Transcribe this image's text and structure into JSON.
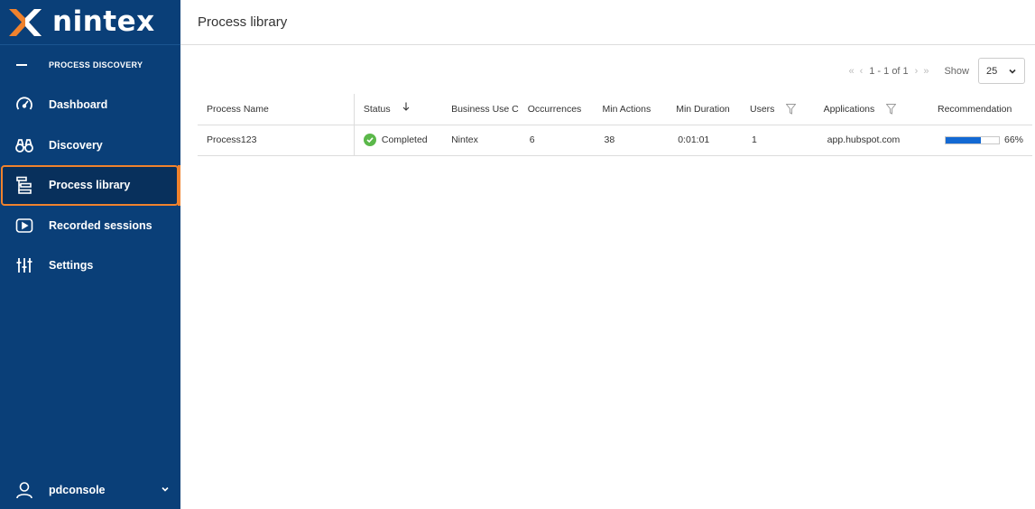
{
  "brand": {
    "name": "nintex",
    "accent": "#f0822d",
    "sidebar_bg": "#0a3f78"
  },
  "sidebar": {
    "section_label": "PROCESS DISCOVERY",
    "items": [
      {
        "label": "Dashboard",
        "icon": "gauge-icon",
        "active": false
      },
      {
        "label": "Discovery",
        "icon": "binoculars-icon",
        "active": false
      },
      {
        "label": "Process library",
        "icon": "process-tree-icon",
        "active": true
      },
      {
        "label": "Recorded sessions",
        "icon": "play-icon",
        "active": false
      },
      {
        "label": "Settings",
        "icon": "sliders-icon",
        "active": false
      }
    ],
    "user": {
      "name": "pdconsole",
      "icon": "user-icon"
    }
  },
  "header": {
    "title": "Process library"
  },
  "pager": {
    "range": "1 - 1 of 1",
    "show_label": "Show",
    "page_size": "25"
  },
  "table": {
    "columns": [
      "Process Name",
      "Status",
      "Business Use C",
      "Occurrences",
      "Min Actions",
      "Min Duration",
      "Users",
      "Applications",
      "Recommendation"
    ],
    "rows": [
      {
        "process_name": "Process123",
        "status": "Completed",
        "business_use_case": "Nintex",
        "occurrences": "6",
        "min_actions": "38",
        "min_duration": "0:01:01",
        "users": "1",
        "applications": "app.hubspot.com",
        "recommendation": "66%",
        "recommendation_fraction": 0.66
      }
    ]
  }
}
